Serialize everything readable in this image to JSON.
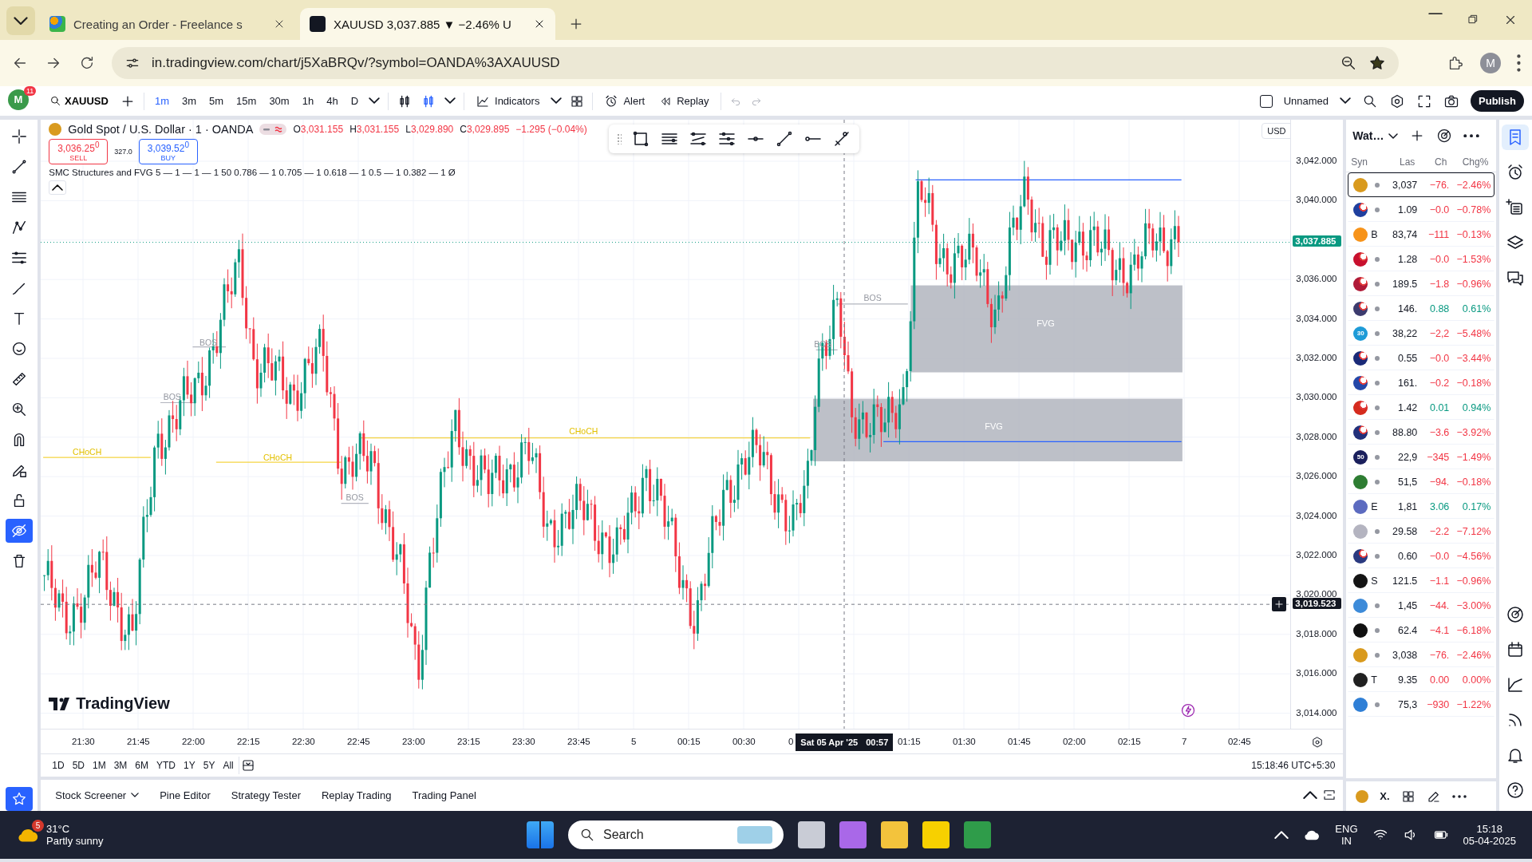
{
  "browser": {
    "tabs": [
      {
        "title": "Creating an Order - Freelance s",
        "selected": false
      },
      {
        "title": "XAUUSD 3,037.885 ▼ −2.46% U",
        "selected": true
      }
    ],
    "address": "in.tradingview.com/chart/j5XaBRQv/?symbol=OANDA%3AXAUUSD",
    "profile": "M"
  },
  "toolbar": {
    "avatar": "M",
    "notifications": "11",
    "symbol": "XAUUSD",
    "intervals": [
      {
        "label": "1m",
        "selected": true
      },
      {
        "label": "3m",
        "selected": false
      },
      {
        "label": "5m",
        "selected": false
      },
      {
        "label": "15m",
        "selected": false
      },
      {
        "label": "30m",
        "selected": false
      },
      {
        "label": "1h",
        "selected": false
      },
      {
        "label": "4h",
        "selected": false
      },
      {
        "label": "D",
        "selected": false
      }
    ],
    "indicators": "Indicators",
    "alert": "Alert",
    "replay": "Replay",
    "layout": {
      "name": "Unnamed",
      "checked": false
    },
    "publish": "Publish"
  },
  "left_tools": [
    {
      "kind": "crosshair",
      "selected": false
    },
    {
      "kind": "line",
      "selected": false
    },
    {
      "kind": "lines",
      "selected": false
    },
    {
      "kind": "nodes",
      "selected": false
    },
    {
      "kind": "fib",
      "selected": false
    },
    {
      "kind": "brush",
      "selected": false
    },
    {
      "kind": "text",
      "selected": false
    },
    {
      "kind": "smiley",
      "selected": false
    },
    {
      "kind": "ruler",
      "selected": false
    },
    {
      "kind": "zoom",
      "selected": false
    },
    {
      "kind": "magnet",
      "selected": false
    },
    {
      "kind": "pencil-lock",
      "selected": false
    },
    {
      "kind": "lock",
      "selected": false
    },
    {
      "kind": "eye-off",
      "selected": true
    },
    {
      "kind": "trash",
      "selected": false
    }
  ],
  "chart": {
    "title": "Gold Spot / U.S. Dollar · 1 · OANDA",
    "ohlc": [
      {
        "label": "O",
        "value": "3,031.155"
      },
      {
        "label": "H",
        "value": "3,031.155"
      },
      {
        "label": "L",
        "value": "3,029.890"
      },
      {
        "label": "C",
        "value": "3,029.895"
      }
    ],
    "change": "−1.295 (−0.04%)",
    "sell": {
      "price": "3,036.25$^{0}$",
      "label": "SELL"
    },
    "spread": "327.0",
    "buy": {
      "price": "3,039.52$^{0}$",
      "label": "BUY"
    },
    "indicator": "SMC Structures and FVG 5 — 1 — 1 — 1 50 0.786 — 1 0.705 — 1 0.618 — 1 0.5 — 1 0.382 — 1  Ø",
    "currency": "USD",
    "annotations": [
      {
        "kind": "choch",
        "label": "CHoCH"
      },
      {
        "kind": "choch",
        "label": "CHoCH"
      },
      {
        "kind": "choch",
        "label": "CHoCH"
      },
      {
        "kind": "bos",
        "label": "BOS"
      },
      {
        "kind": "bos",
        "label": "BOS"
      },
      {
        "kind": "bos",
        "label": "BOS"
      },
      {
        "kind": "bos",
        "label": "BOS"
      },
      {
        "kind": "bos",
        "label": "BOS"
      },
      {
        "kind": "fvg",
        "label": "FVG"
      },
      {
        "kind": "fvg",
        "label": "FVG"
      }
    ],
    "price_axis": [
      "3,042.000",
      "3,040.000",
      "3,036.000",
      "3,034.000",
      "3,032.000",
      "3,030.000",
      "3,028.000",
      "3,026.000",
      "3,024.000",
      "3,022.000",
      "3,020.000",
      "3,018.000",
      "3,016.000",
      "3,014.000"
    ],
    "last_price": "3,037.885",
    "crosshair_price": "3,019.523",
    "time_axis": [
      "21:30",
      "21:45",
      "22:00",
      "22:15",
      "22:30",
      "22:45",
      "23:00",
      "23:15",
      "23:30",
      "23:45",
      "5",
      "00:15",
      "00:30",
      "0",
      "01:15",
      "01:30",
      "01:45",
      "02:00",
      "02:15",
      "7",
      "02:45"
    ],
    "crosshair": {
      "date": "Sat 05 Apr '25",
      "time": "00:57"
    },
    "logo": "TradingView"
  },
  "ranges": [
    "1D",
    "5D",
    "1M",
    "3M",
    "6M",
    "YTD",
    "1Y",
    "5Y",
    "All"
  ],
  "clock": "15:18:46 UTC+5:30",
  "bottom_tabs": [
    {
      "label": "Stock Screener",
      "dropdown": true
    },
    {
      "label": "Pine Editor",
      "dropdown": false
    },
    {
      "label": "Strategy Tester",
      "dropdown": false
    },
    {
      "label": "Replay Trading",
      "dropdown": false
    },
    {
      "label": "Trading Panel",
      "dropdown": false
    }
  ],
  "watchlist": {
    "title": "Wat…",
    "columns": [
      "Syn",
      "Las",
      "Ch",
      "Chg%"
    ],
    "rows": [
      {
        "kind": "coin",
        "color": "#d99a1e",
        "last": "3,037",
        "change": "−76.",
        "change_pct": "−2.46%",
        "rising": false,
        "selected": true
      },
      {
        "kind": "pair",
        "color": "#1f3f9e",
        "last": "1.09",
        "change": "−0.0",
        "change_pct": "−0.78%",
        "rising": false,
        "selected": false
      },
      {
        "kind": "coin",
        "color": "#f7931a",
        "ticker": "B",
        "last": "83,74",
        "change": "−111",
        "change_pct": "−0.13%",
        "rising": false,
        "selected": false
      },
      {
        "kind": "pair",
        "color": "#c8102e",
        "last": "1.28",
        "change": "−0.0",
        "change_pct": "−1.53%",
        "rising": false,
        "selected": false
      },
      {
        "kind": "pair",
        "color": "#b01a38",
        "last": "189.5",
        "change": "−1.8",
        "change_pct": "−0.96%",
        "rising": false,
        "selected": false
      },
      {
        "kind": "pair",
        "color": "#3c3b6e",
        "last": "146.",
        "change": "0.88",
        "change_pct": "0.61%",
        "rising": true,
        "selected": false
      },
      {
        "kind": "coin",
        "color": "#1e9bd7",
        "badge": "30",
        "last": "38,22",
        "change": "−2,2",
        "change_pct": "−5.48%",
        "rising": false,
        "selected": false
      },
      {
        "kind": "pair",
        "color": "#1a2a78",
        "last": "0.55",
        "change": "−0.0",
        "change_pct": "−3.44%",
        "rising": false,
        "selected": false
      },
      {
        "kind": "pair",
        "color": "#2447a8",
        "last": "161.",
        "change": "−0.2",
        "change_pct": "−0.18%",
        "rising": false,
        "selected": false
      },
      {
        "kind": "pair",
        "color": "#d52b1e",
        "last": "1.42",
        "change": "0.01",
        "change_pct": "0.94%",
        "rising": true,
        "selected": false
      },
      {
        "kind": "pair",
        "color": "#22307a",
        "last": "88.80",
        "change": "−3.6",
        "change_pct": "−3.92%",
        "rising": false,
        "selected": false
      },
      {
        "kind": "coin",
        "color": "#1a1f5c",
        "badge": "50",
        "last": "22,9",
        "change": "−345",
        "change_pct": "−1.49%",
        "rising": false,
        "selected": false
      },
      {
        "kind": "coin",
        "color": "#2e7d32",
        "last": "51,5",
        "change": "−94.",
        "change_pct": "−0.18%",
        "rising": false,
        "selected": false
      },
      {
        "kind": "coin",
        "color": "#5c6bc0",
        "ticker": "E",
        "last": "1,81",
        "change": "3.06",
        "change_pct": "0.17%",
        "rising": true,
        "selected": false
      },
      {
        "kind": "coin",
        "color": "#b4b4c0",
        "last": "29.58",
        "change": "−2.2",
        "change_pct": "−7.12%",
        "rising": false,
        "selected": false
      },
      {
        "kind": "pair",
        "color": "#2a3a80",
        "last": "0.60",
        "change": "−0.0",
        "change_pct": "−4.56%",
        "rising": false,
        "selected": false
      },
      {
        "kind": "coin",
        "color": "#141414",
        "ticker": "S",
        "last": "121.5",
        "change": "−1.1",
        "change_pct": "−0.96%",
        "rising": false,
        "selected": false
      },
      {
        "kind": "coin",
        "color": "#3d8bd9",
        "last": "1,45",
        "change": "−44.",
        "change_pct": "−3.00%",
        "rising": false,
        "selected": false
      },
      {
        "kind": "coin",
        "color": "#101010",
        "last": "62.4",
        "change": "−4.1",
        "change_pct": "−6.18%",
        "rising": false,
        "selected": false
      },
      {
        "kind": "coin",
        "color": "#d99a1e",
        "last": "3,038",
        "change": "−76.",
        "change_pct": "−2.46%",
        "rising": false,
        "selected": false
      },
      {
        "kind": "coin",
        "color": "#202020",
        "ticker": "T",
        "last": "9.35",
        "change": "0.00",
        "change_pct": "0.00%",
        "rising": false,
        "selected": false
      },
      {
        "kind": "coin",
        "color": "#2f7fd6",
        "last": "75,3",
        "change": "−930",
        "change_pct": "−1.22%",
        "rising": false,
        "selected": false
      }
    ],
    "footer": "X."
  },
  "right_tools": [
    {
      "kind": "watchlist",
      "selected": true
    },
    {
      "kind": "alarm",
      "selected": false
    },
    {
      "kind": "list-plus",
      "selected": false
    },
    {
      "kind": "layers",
      "selected": false
    },
    {
      "kind": "chat",
      "selected": false
    },
    {
      "kind": "target",
      "selected": false
    },
    {
      "kind": "calendar",
      "selected": false
    },
    {
      "kind": "chart-line",
      "selected": false
    },
    {
      "kind": "rss",
      "selected": false
    },
    {
      "kind": "bell",
      "selected": false
    },
    {
      "kind": "help",
      "selected": false
    }
  ],
  "taskbar": {
    "weather_badge": "5",
    "temperature": "31°C",
    "condition": "Partly sunny",
    "search": "Search",
    "language": "ENG",
    "region": "IN",
    "time": "15:18",
    "date": "05-04-2025"
  }
}
